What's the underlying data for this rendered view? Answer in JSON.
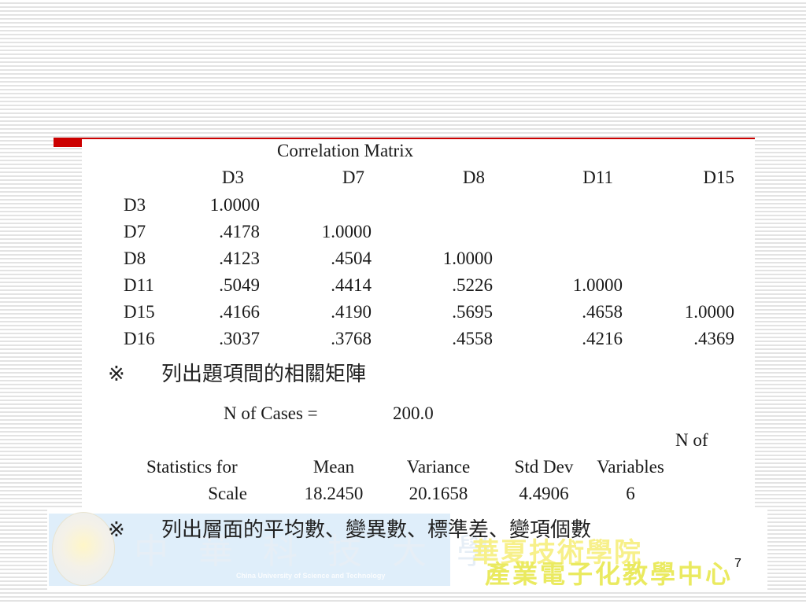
{
  "slide": {
    "page_number": "7",
    "accent_color": "#cc0000"
  },
  "correlation_matrix": {
    "title": "Correlation Matrix",
    "columns": [
      "D3",
      "D7",
      "D8",
      "D11",
      "D15"
    ],
    "rows": [
      {
        "label": "D3",
        "values": [
          "1.0000",
          "",
          "",
          "",
          ""
        ]
      },
      {
        "label": "D7",
        "values": [
          ".4178",
          "1.0000",
          "",
          "",
          ""
        ]
      },
      {
        "label": "D8",
        "values": [
          ".4123",
          ".4504",
          "1.0000",
          "",
          ""
        ]
      },
      {
        "label": "D11",
        "values": [
          ".5049",
          ".4414",
          ".5226",
          "1.0000",
          ""
        ]
      },
      {
        "label": "D15",
        "values": [
          ".4166",
          ".4190",
          ".5695",
          ".4658",
          "1.0000"
        ]
      },
      {
        "label": "D16",
        "values": [
          ".3037",
          ".3768",
          ".4558",
          ".4216",
          ".4369"
        ]
      }
    ]
  },
  "note1": {
    "symbol": "※",
    "text": "列出題項間的相關矩陣"
  },
  "cases": {
    "label": "N of Cases =",
    "value": "200.0"
  },
  "scale_stats": {
    "header_top": "N of",
    "row_label_top": "Statistics for",
    "row_label": "Scale",
    "columns": [
      "Mean",
      "Variance",
      "Std Dev",
      "Variables"
    ],
    "values": [
      "18.2450",
      "20.1658",
      "4.4906",
      "6"
    ]
  },
  "note2": {
    "symbol": "※",
    "text": "列出層面的平均數、變異數、標準差、變項個數"
  },
  "banner": {
    "calligraphy": "中華科技大學",
    "english": "China University of Science and Technology",
    "yellow_top": "華夏技術學院",
    "yellow_bottom": "產業電子化教學中心"
  }
}
